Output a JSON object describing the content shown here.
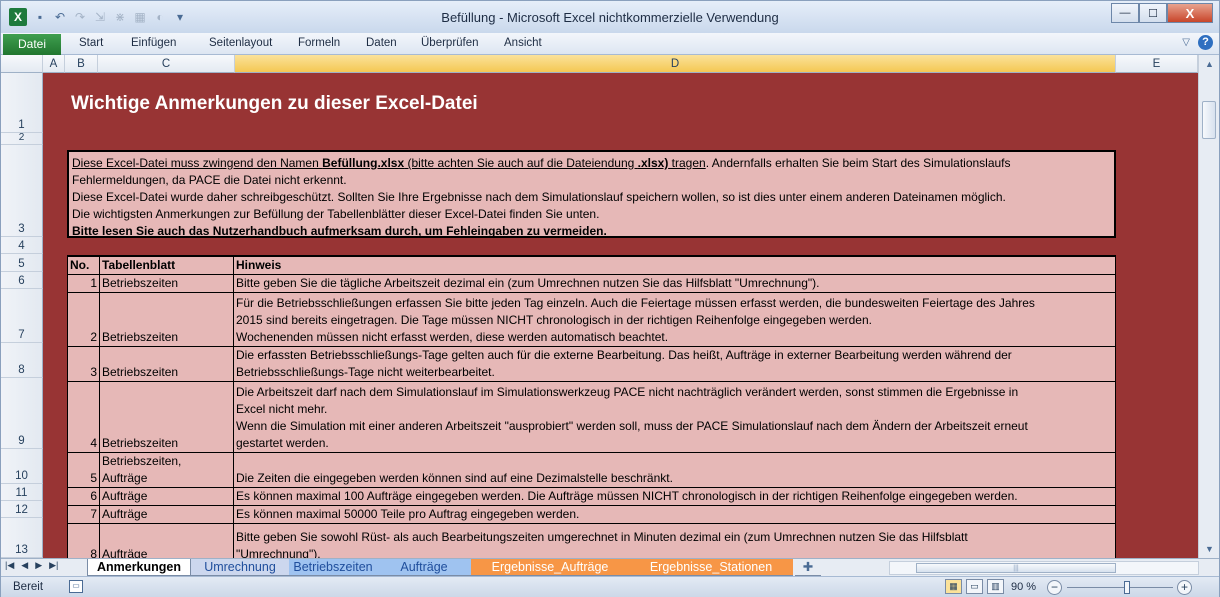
{
  "window": {
    "title": "Befüllung  -  Microsoft Excel nichtkommerzielle Verwendung",
    "controls": {
      "minimize": "—",
      "maximize": "☐",
      "close": "X"
    }
  },
  "qat": {
    "excel_icon": "X",
    "save_icon": "save-icon",
    "undo_icon": "undo-icon",
    "redo_icon": "redo-icon"
  },
  "ribbon": {
    "file_tab": "Datei",
    "tabs": [
      "Start",
      "Einfügen",
      "Seitenlayout",
      "Formeln",
      "Daten",
      "Überprüfen",
      "Ansicht"
    ],
    "help": "?"
  },
  "columns": [
    "A",
    "B",
    "C",
    "D",
    "E"
  ],
  "selected_column": "D",
  "rows": [
    "1",
    "2",
    "3",
    "4",
    "5",
    "6",
    "7",
    "8",
    "9",
    "10",
    "11",
    "12",
    "13"
  ],
  "sheet": {
    "title": "Wichtige Anmerkungen zu dieser Excel-Datei",
    "notes": {
      "line1_pre": "Diese Excel-Datei muss zwingend den Namen ",
      "line1_bold": "Befüllung.xlsx",
      "line1_mid": " (bitte achten Sie auch auf die Dateiendung ",
      "line1_bold2": ".xlsx)",
      "line1_post": " tragen",
      "line1_tail": ". Andernfalls erhalten Sie beim Start des Simulationslaufs",
      "line2": "Fehlermeldungen, da PACE die Datei nicht erkennt.",
      "line3": "Diese Excel-Datei wurde daher schreibgeschützt. Sollten Sie Ihre Ergebnisse nach dem Simulationslauf speichern wollen, so ist dies unter einem anderen Dateinamen möglich.",
      "line4": "Die wichtigsten Anmerkungen zur Befüllung der Tabellenblätter dieser Excel-Datei finden Sie unten.",
      "line5": "Bitte lesen Sie auch das Nutzerhandbuch aufmerksam durch, um Fehleingaben zu vermeiden."
    },
    "table": {
      "headers": {
        "no": "No.",
        "sheet": "Tabellenblatt",
        "hint": "Hinweis"
      },
      "rows": [
        {
          "no": "1",
          "sheet": [
            "Betriebszeiten"
          ],
          "hint": [
            "Bitte geben Sie die tägliche Arbeitszeit dezimal ein (zum Umrechnen nutzen Sie das Hilfsblatt \"Umrechnung\")."
          ]
        },
        {
          "no": "2",
          "sheet": [
            "Betriebszeiten"
          ],
          "hint": [
            "Für die Betriebsschließungen erfassen Sie bitte jeden Tag einzeln. Auch die Feiertage müssen erfasst werden, die bundesweiten Feiertage des Jahres",
            "2015 sind bereits eingetragen. Die Tage müssen NICHT chronologisch in der richtigen Reihenfolge eingegeben werden.",
            "Wochenenden müssen nicht erfasst werden, diese werden automatisch beachtet."
          ]
        },
        {
          "no": "3",
          "sheet": [
            "Betriebszeiten"
          ],
          "hint": [
            "Die erfassten Betriebsschließungs-Tage gelten auch für die externe Bearbeitung. Das heißt, Aufträge in externer Bearbeitung werden während der",
            "Betriebsschließungs-Tage nicht weiterbearbeitet."
          ]
        },
        {
          "no": "4",
          "sheet": [
            "Betriebszeiten"
          ],
          "hint": [
            "Die Arbeitszeit darf nach dem Simulationslauf im Simulationswerkzeug PACE nicht nachträglich verändert werden, sonst stimmen die Ergebnisse in",
            "Excel nicht mehr.",
            "Wenn die Simulation mit einer anderen Arbeitszeit \"ausprobiert\" werden soll, muss der PACE Simulationslauf nach dem Ändern der Arbeitszeit erneut",
            "gestartet werden."
          ]
        },
        {
          "no": "5",
          "sheet": [
            "Betriebszeiten,",
            "Aufträge"
          ],
          "hint": [
            "Die Zeiten die eingegeben werden können sind auf eine Dezimalstelle beschränkt."
          ]
        },
        {
          "no": "6",
          "sheet": [
            "Aufträge"
          ],
          "hint": [
            "Es können maximal 100 Aufträge eingegeben werden. Die Aufträge müssen NICHT chronologisch in der richtigen Reihenfolge eingegeben werden."
          ]
        },
        {
          "no": "7",
          "sheet": [
            "Aufträge"
          ],
          "hint": [
            "Es können maximal 50000 Teile pro Auftrag eingegeben werden."
          ]
        },
        {
          "no": "8",
          "sheet": [
            "Aufträge"
          ],
          "hint": [
            "Bitte geben Sie sowohl Rüst- als auch Bearbeitungszeiten umgerechnet in Minuten dezimal ein (zum Umrechnen nutzen Sie das Hilfsblatt",
            "\"Umrechnung\")."
          ]
        }
      ]
    }
  },
  "sheet_tabs": [
    {
      "label": "Anmerkungen",
      "active": true,
      "color": "#ffffff",
      "text_color": "#000000"
    },
    {
      "label": "Umrechnung",
      "active": false,
      "color": "#ccd7ee",
      "text_color": "#1f4e9c"
    },
    {
      "label": "Betriebszeiten",
      "active": false,
      "color": "#9fc3f0",
      "text_color": "#1f4e9c"
    },
    {
      "label": "Aufträge",
      "active": false,
      "color": "#9fc3f0",
      "text_color": "#1f4e9c"
    },
    {
      "label": "Ergebnisse_Aufträge",
      "active": false,
      "color": "#f79646",
      "text_color": "#ffffff"
    },
    {
      "label": "Ergebnisse_Stationen",
      "active": false,
      "color": "#f79646",
      "text_color": "#ffffff"
    }
  ],
  "status": {
    "ready": "Bereit",
    "zoom": "90 %"
  },
  "colors": {
    "sheet_background": "#983434",
    "cell_fill": "#e6b8b7",
    "ribbon_file": "#21762f",
    "selected_header": "#f4c854"
  }
}
